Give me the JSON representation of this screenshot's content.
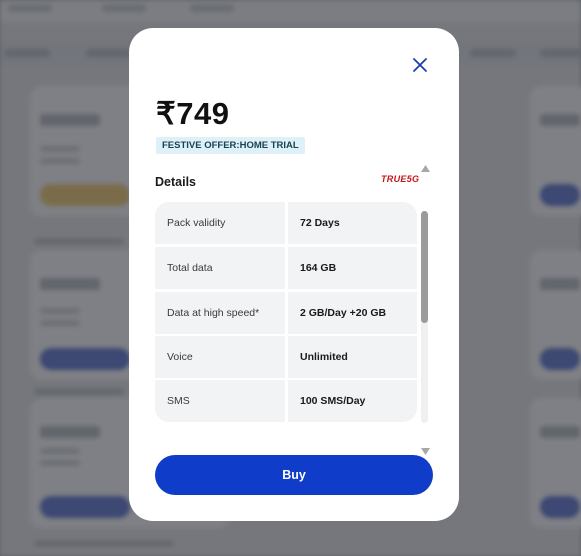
{
  "modal": {
    "price": "₹749",
    "offer_badge": "FESTIVE OFFER:HOME TRIAL",
    "details_title": "Details",
    "network_badge": "TRUE5G",
    "details": [
      {
        "label": "Pack validity",
        "value": "72 Days"
      },
      {
        "label": "Total data",
        "value": "164 GB"
      },
      {
        "label": "Data at high speed*",
        "value": "2 GB/Day +20 GB"
      },
      {
        "label": "Voice",
        "value": "Unlimited"
      },
      {
        "label": "SMS",
        "value": "100 SMS/Day"
      }
    ],
    "buy_label": "Buy",
    "close_icon": "close-icon",
    "accent_color": "#0f3cc9"
  }
}
